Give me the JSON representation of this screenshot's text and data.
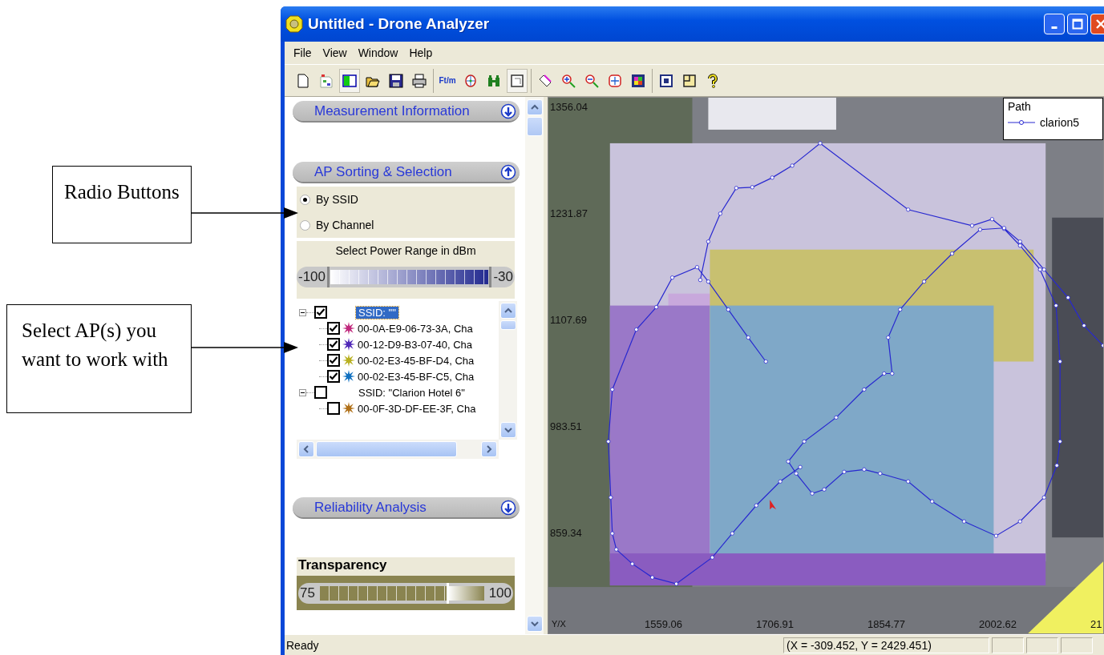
{
  "annotations": [
    {
      "text": "Radio Buttons"
    },
    {
      "text": "Select AP(s) you want to work with"
    }
  ],
  "window": {
    "title": "Untitled - Drone Analyzer"
  },
  "menu": [
    "File",
    "View",
    "Window",
    "Help"
  ],
  "toolbar": [
    [
      {
        "kind": "new",
        "selected": false
      },
      {
        "kind": "map",
        "selected": false
      },
      {
        "kind": "split",
        "selected": true
      },
      {
        "kind": "open",
        "selected": false
      },
      {
        "kind": "save",
        "selected": false
      },
      {
        "kind": "print",
        "selected": false
      }
    ],
    [
      {
        "kind": "units",
        "label": "Ft/m",
        "selected": false
      },
      {
        "kind": "compass",
        "selected": false
      },
      {
        "kind": "binoculars",
        "selected": false
      },
      {
        "kind": "frame",
        "selected": true
      }
    ],
    [
      {
        "kind": "ruler",
        "selected": false
      },
      {
        "kind": "zoom-in",
        "selected": false
      },
      {
        "kind": "zoom-out",
        "selected": false
      },
      {
        "kind": "fit",
        "selected": false
      },
      {
        "kind": "colormap",
        "selected": false
      }
    ],
    [
      {
        "kind": "layers",
        "selected": false
      },
      {
        "kind": "panel",
        "selected": false
      },
      {
        "kind": "help",
        "selected": false
      }
    ]
  ],
  "sections": [
    {
      "title": "Measurement Information",
      "expanded": false
    },
    {
      "title": "AP Sorting & Selection",
      "expanded": true
    },
    {
      "title": "Reliability Analysis",
      "expanded": false
    }
  ],
  "sorting": [
    {
      "label": "By SSID",
      "selected": true
    },
    {
      "label": "By Channel",
      "selected": false
    }
  ],
  "power_range": {
    "title": "Select Power Range in dBm",
    "min_label": "-100",
    "max_label": "-30",
    "thumbs": [
      {
        "level": 0
      },
      {
        "level": 1
      }
    ]
  },
  "ap_tree": [
    {
      "label": "SSID: \"\"",
      "checked": true,
      "selected": true,
      "children": [
        {
          "label": "00-0A-E9-06-73-3A, Cha",
          "checked": true,
          "color": "#c0287c"
        },
        {
          "label": "00-12-D9-B3-07-40, Cha",
          "checked": true,
          "color": "#5028b8"
        },
        {
          "label": "00-02-E3-45-BF-D4, Cha",
          "checked": true,
          "color": "#b8b020"
        },
        {
          "label": "00-02-E3-45-BF-C5, Cha",
          "checked": true,
          "color": "#1070c0"
        }
      ]
    },
    {
      "label": "SSID: \"Clarion Hotel 6\"",
      "checked": false,
      "selected": false,
      "children": [
        {
          "label": "00-0F-3D-DF-EE-3F, Cha",
          "checked": false,
          "color": "#b07018"
        }
      ]
    }
  ],
  "transparency": {
    "title": "Transparency",
    "min_label": "75",
    "max_label": "100",
    "level": 0.77
  },
  "map": {
    "y_labels": [
      "1356.04",
      "1231.87",
      "1107.69",
      "983.51",
      "859.34"
    ],
    "x_labels": [
      "1559.06",
      "1706.91",
      "1854.77",
      "2002.62",
      "21"
    ],
    "corner_label": "Y/X",
    "legend": {
      "title": "Path",
      "series": "clarion5"
    }
  },
  "status_bar": {
    "text": "Ready",
    "coordinates": "(X = -309.452, Y = 2429.451)"
  }
}
